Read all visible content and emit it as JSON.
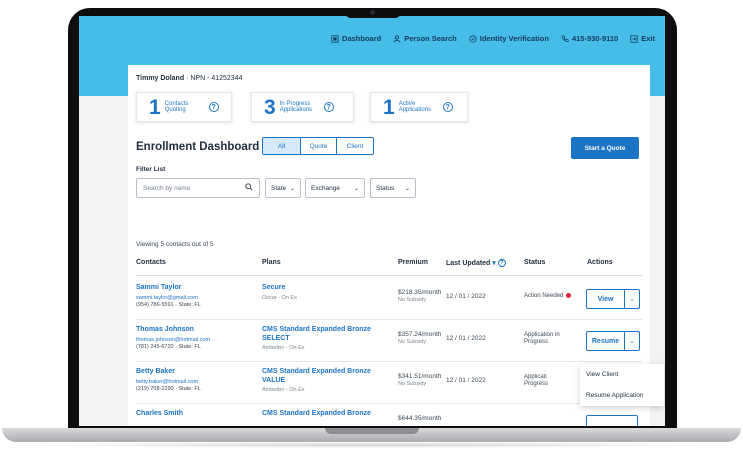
{
  "nav": {
    "items": [
      {
        "label": "Dashboard",
        "icon": "dashboard-icon"
      },
      {
        "label": "Person Search",
        "icon": "person-icon"
      },
      {
        "label": "Identity Verification",
        "icon": "shield-icon"
      },
      {
        "label": "415-930-9110",
        "icon": "phone-icon"
      },
      {
        "label": "Exit",
        "icon": "exit-icon"
      }
    ]
  },
  "agent": {
    "name": "Timmy Doland",
    "npn": "NPN - 41252344"
  },
  "stats": [
    {
      "value": "1",
      "label_line1": "Contacts",
      "label_line2": "Quoting"
    },
    {
      "value": "3",
      "label_line1": "In Progress",
      "label_line2": "Applications"
    },
    {
      "value": "1",
      "label_line1": "Active",
      "label_line2": "Applications"
    }
  ],
  "dashboard": {
    "title": "Enrollment Dashboard",
    "tabs": [
      "All",
      "Quote",
      "Client"
    ],
    "active_tab": "All",
    "start_quote": "Start a Quote"
  },
  "filters": {
    "label": "Filter List",
    "search_placeholder": "Search by name",
    "state": "State",
    "exchange": "Exchange",
    "status": "Status"
  },
  "table": {
    "viewing": "Viewing 5 contacts out of 5",
    "headers": {
      "contacts": "Contacts",
      "plans": "Plans",
      "premium": "Premium",
      "last_updated": "Last Updated",
      "status": "Status",
      "actions": "Actions"
    },
    "rows": [
      {
        "name": "Sammi Taylor",
        "email": "sammi.taylor@gmail.com",
        "phone": "(954) 786-5591 · State: FL",
        "plan": "Secure",
        "plan_sub": "Oscar - On Ex",
        "premium": "$218.35/month",
        "subsidy": "No Subsidy",
        "updated": "12 / 01 / 2022",
        "status": "Action Needed",
        "action": "View"
      },
      {
        "name": "Thomas Johnson",
        "email": "thomas.johnson@hotmail.com",
        "phone": "(781) 245-6720 · State: FL",
        "plan": "CMS Standard Expanded Bronze SELECT",
        "plan_sub": "Ambetter - On Ex",
        "premium": "$357.24/month",
        "subsidy": "No Subsidy",
        "updated": "12 / 01 / 2022",
        "status": "Application in Progress",
        "action": "Resume"
      },
      {
        "name": "Betty Baker",
        "email": "betty.baker@hotmail.com",
        "phone": "(219) 708-2290 · State: FL",
        "plan": "CMS Standard Expanded Bronze VALUE",
        "plan_sub": "Ambetter - On Ex",
        "premium": "$341.51/month",
        "subsidy": "No Subsidy",
        "updated": "12 / 01 / 2022",
        "status": "Applicati Progress",
        "action": ""
      },
      {
        "name": "Charles Smith",
        "email": "",
        "phone": "",
        "plan": "CMS Standard Expanded Bronze",
        "plan_sub": "",
        "premium": "$644.35/month",
        "subsidy": "",
        "updated": "",
        "status": "",
        "action": ""
      }
    ]
  },
  "dropdown_menu": [
    "View Client",
    "Resume Application"
  ],
  "colors": {
    "header_blue": "#45bde8",
    "primary": "#1b74c6",
    "alert": "#e0253a"
  }
}
